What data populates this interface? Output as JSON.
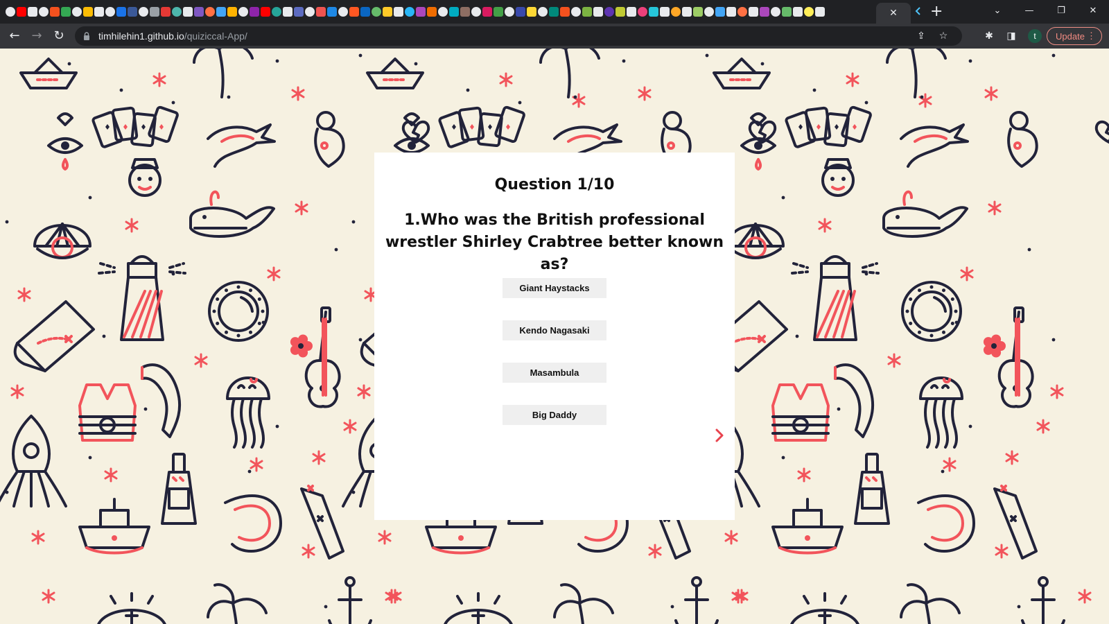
{
  "browser": {
    "url_host": "timhilehin1.github.io",
    "url_path": "/quiziccal-App/",
    "active_tab_close_icon": "close-icon",
    "new_tab_symbol": "+",
    "profile_initial": "t",
    "update_label": "Update",
    "menu_symbol": "⋮",
    "back_symbol": "←",
    "forward_symbol": "→",
    "reload_symbol": "↻"
  },
  "quiz": {
    "counter": "Question 1/10",
    "question": "1.Who was the British professional wrestler Shirley Crabtree better known as?",
    "answers": [
      "Giant Haystacks",
      "Kendo Nagasaki",
      "Masambula",
      "Big Daddy"
    ],
    "next_icon": "chevron-right-icon"
  },
  "colors": {
    "page_background": "#f6f1e1",
    "pattern_ink": "#22233a",
    "pattern_accent": "#f2545b",
    "card": "#ffffff",
    "answer_button": "#efefef",
    "next_arrow": "#e8434e",
    "update_accent": "#f28b82"
  }
}
